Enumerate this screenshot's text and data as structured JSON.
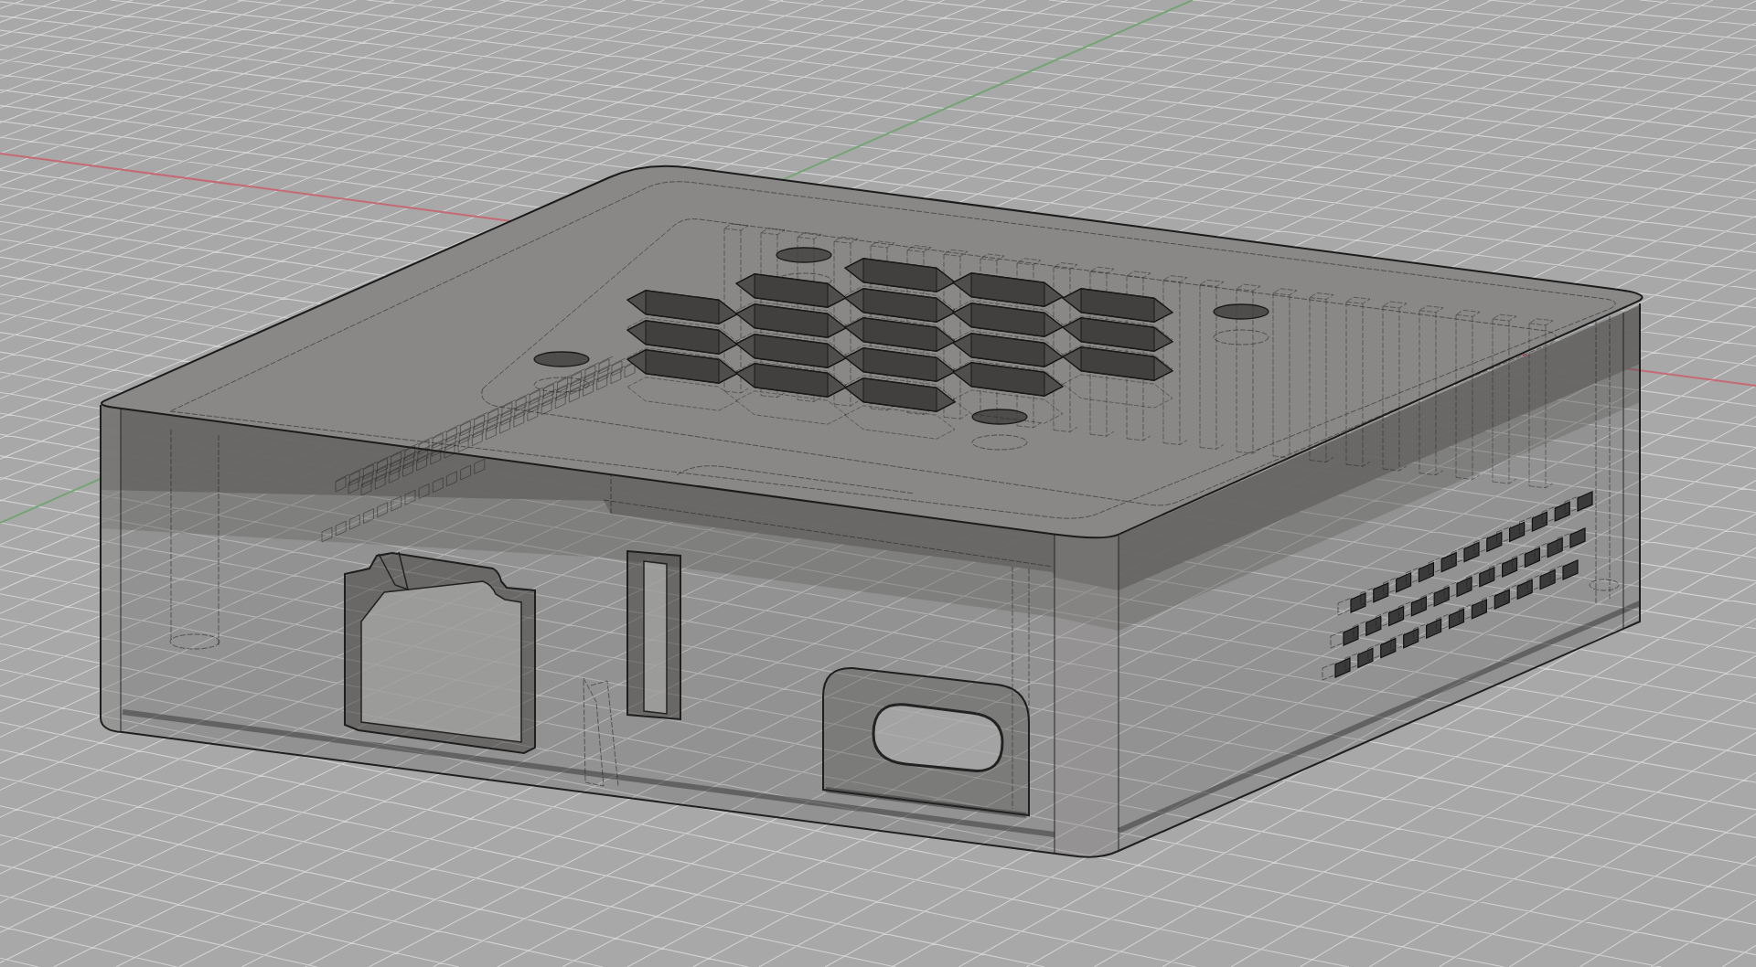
{
  "viewport": {
    "axes": [
      {
        "color": "#c46a74"
      },
      {
        "color": "#74a474"
      }
    ]
  }
}
